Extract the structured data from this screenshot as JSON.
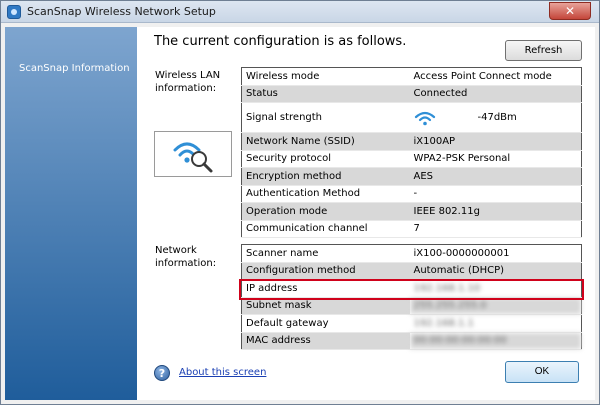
{
  "window": {
    "title": "ScanSnap Wireless Network Setup",
    "close_glyph": "✕"
  },
  "sidebar": {
    "item": "ScanSnap Information"
  },
  "header": {
    "title": "The current configuration is as follows.",
    "refresh_label": "Refresh"
  },
  "wireless": {
    "label": "Wireless LAN information:",
    "rows": [
      {
        "key": "Wireless mode",
        "value": "Access Point Connect mode"
      },
      {
        "key": "Status",
        "value": "Connected"
      },
      {
        "key": "Signal strength",
        "value": "-47dBm"
      },
      {
        "key": "Network Name (SSID)",
        "value": "iX100AP"
      },
      {
        "key": "Security protocol",
        "value": "WPA2-PSK Personal"
      },
      {
        "key": "Encryption method",
        "value": "AES"
      },
      {
        "key": "Authentication Method",
        "value": "-"
      },
      {
        "key": "Operation mode",
        "value": "IEEE 802.11g"
      },
      {
        "key": "Communication channel",
        "value": "7"
      }
    ]
  },
  "network": {
    "label": "Network information:",
    "rows": [
      {
        "key": "Scanner name",
        "value": "iX100-0000000001"
      },
      {
        "key": "Configuration method",
        "value": "Automatic (DHCP)"
      },
      {
        "key": "IP address",
        "value": "192.168.1.10"
      },
      {
        "key": "Subnet mask",
        "value": "255.255.255.0"
      },
      {
        "key": "Default gateway",
        "value": "192.168.1.1"
      },
      {
        "key": "MAC address",
        "value": "00:00:00:00:00:00"
      }
    ]
  },
  "footer": {
    "help_link": "About this screen",
    "help_glyph": "?",
    "ok_label": "OK"
  },
  "colors": {
    "highlight": "#d0021b",
    "link": "#1a3fb3",
    "wifi_icon": "#2f8fd6"
  }
}
